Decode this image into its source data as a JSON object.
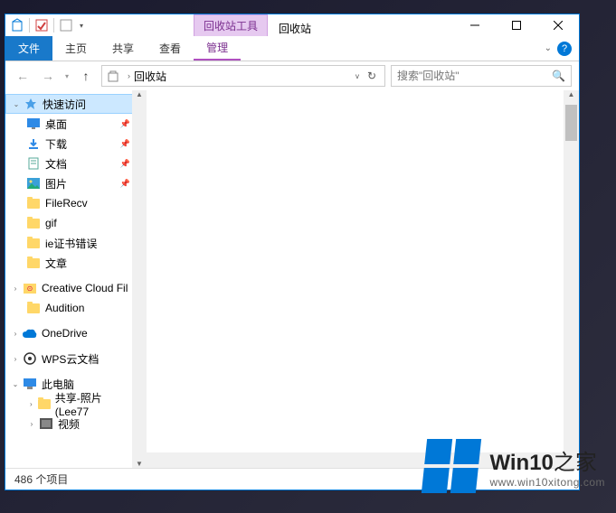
{
  "titlebar": {
    "tool_tab": "回收站工具",
    "app_title": "回收站"
  },
  "ribbon": {
    "file": "文件",
    "home": "主页",
    "share": "共享",
    "view": "查看",
    "manage": "管理"
  },
  "address": {
    "location": "回收站"
  },
  "search": {
    "placeholder": "搜索\"回收站\""
  },
  "tree": {
    "quick_access": "快速访问",
    "desktop": "桌面",
    "downloads": "下载",
    "documents": "文档",
    "pictures": "图片",
    "filerecv": "FileRecv",
    "gif": "gif",
    "ie_cert": "ie证书错误",
    "article": "文章",
    "creative_cloud": "Creative Cloud Fil",
    "audition": "Audition",
    "onedrive": "OneDrive",
    "wps": "WPS云文档",
    "this_pc": "此电脑",
    "shared_photos": "共享-照片 (Lee77",
    "video": "视频"
  },
  "status": {
    "items": "486 个项目"
  },
  "watermark": {
    "line1_a": "Win10",
    "line1_b": "之家",
    "line2": "www.win10xitong.com"
  }
}
